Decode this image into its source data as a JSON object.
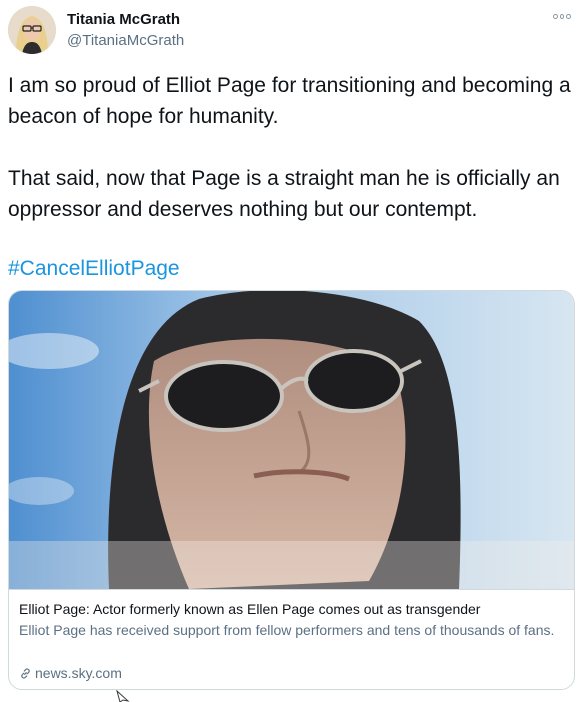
{
  "author": {
    "name": "Titania McGrath",
    "handle": "@TitaniaMcGrath"
  },
  "tweet": {
    "paragraphs": [
      "I am so proud of Elliot Page for transitioning and becoming a beacon of hope for humanity.",
      "That said, now that Page is a straight man he is officially an oppressor and deserves nothing but our contempt."
    ],
    "hashtag": "#CancelElliotPage"
  },
  "link_card": {
    "title": "Elliot Page: Actor formerly known as Ellen Page comes out as transgender",
    "description": "Elliot Page has received support from fellow performers and tens of thousands of fans.",
    "domain": "news.sky.com"
  },
  "icons": {
    "more": "more-options-icon",
    "link": "link-icon",
    "cursor": "mouse-cursor-icon"
  },
  "colors": {
    "text": "#0f1419",
    "secondary": "#5b7083",
    "link": "#1b95e0",
    "border": "#cfd9de"
  }
}
